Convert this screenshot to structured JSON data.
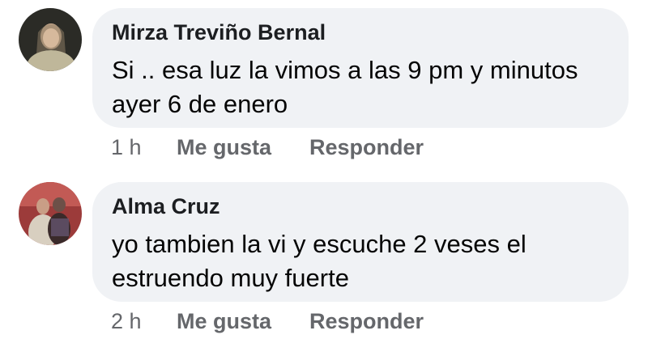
{
  "comments": [
    {
      "author": "Mirza Treviño Bernal",
      "text": "Si .. esa luz la vimos a las 9 pm y minutos ayer 6 de enero",
      "time": "1 h",
      "like_label": "Me gusta",
      "reply_label": "Responder"
    },
    {
      "author": "Alma Cruz",
      "text": "yo tambien la vi y escuche 2 veses el estruendo muy fuerte",
      "time": "2 h",
      "like_label": "Me gusta",
      "reply_label": "Responder"
    }
  ],
  "colors": {
    "bubble": "#f0f2f5",
    "meta_text": "#65676b",
    "name_text": "#1c1e21"
  }
}
